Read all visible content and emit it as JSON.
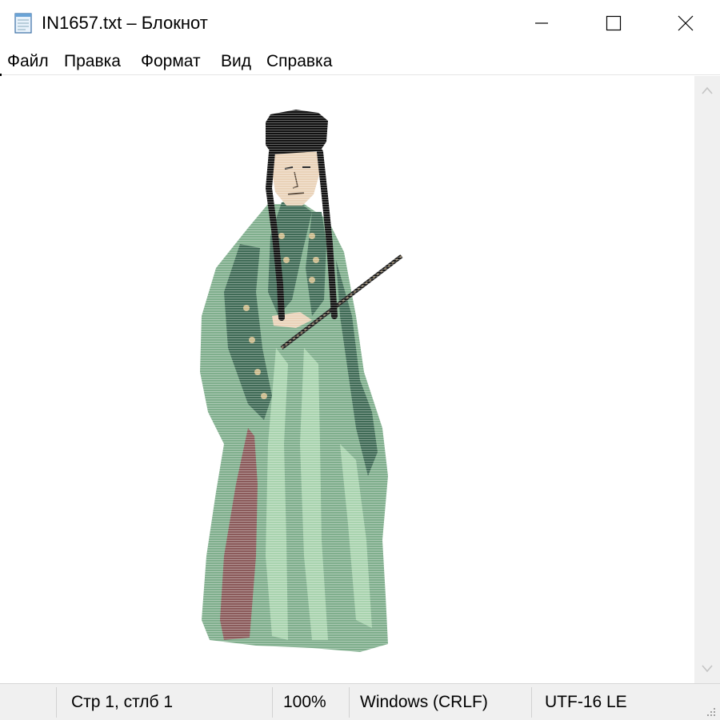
{
  "window": {
    "title": "IN1657.txt – Блокнот",
    "icon": "notepad-icon",
    "controls": [
      "minimize-icon",
      "maximize-icon",
      "close-icon"
    ]
  },
  "menu": {
    "items": [
      "Файл",
      "Правка",
      "Формат",
      "Вид",
      "Справка"
    ]
  },
  "editor": {
    "content_image": "figure-in-green-robe-with-stick"
  },
  "scrollbar": {
    "up_icon": "chevron-up-icon",
    "down_icon": "chevron-down-icon"
  },
  "status": {
    "position": "Стр 1, стлб 1",
    "zoom": "100%",
    "line_endings": "Windows (CRLF)",
    "encoding": "UTF-16 LE"
  },
  "colors": {
    "robe_green": "#7fae8c",
    "robe_dark": "#3f6a55",
    "robe_light": "#a8d3ae",
    "underskirt": "#8a5a5a",
    "hat": "#111111",
    "skin": "#e9d2b8"
  }
}
